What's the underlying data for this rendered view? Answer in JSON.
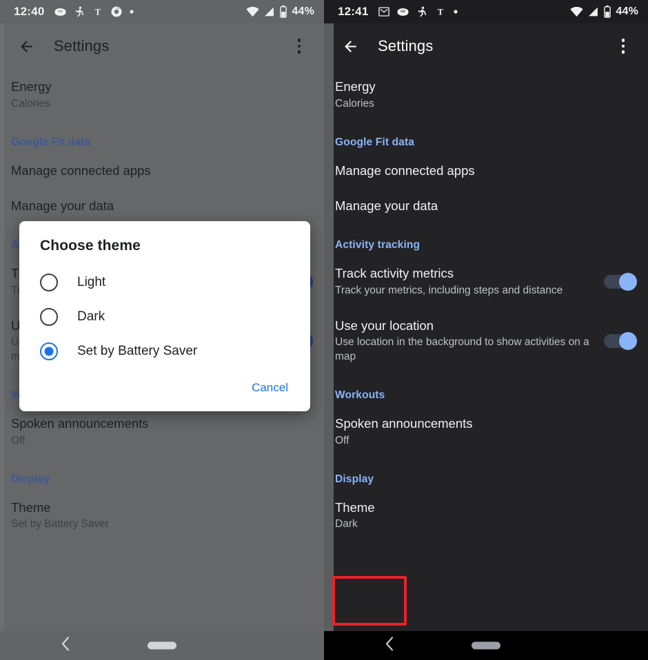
{
  "left_panel": {
    "theme": "light-scrimmed",
    "status_bar": {
      "clock": "12:40",
      "battery_text": "44%",
      "icons": [
        "fit-icon",
        "running-person-icon",
        "nyt-icon",
        "chrome-icon",
        "dot-icon"
      ],
      "right_icons": [
        "wifi-icon",
        "signal-icon",
        "battery-icon"
      ]
    },
    "app_bar": {
      "back_icon": "arrow-back-icon",
      "title": "Settings",
      "more_icon": "overflow-menu-icon"
    },
    "list": [
      {
        "kind": "item",
        "title": "Energy",
        "subtitle": "Calories"
      },
      {
        "kind": "section",
        "title": "Google Fit data"
      },
      {
        "kind": "item",
        "title": "Manage connected apps",
        "subtitle": ""
      },
      {
        "kind": "item",
        "title": "Manage your data",
        "subtitle": ""
      },
      {
        "kind": "section",
        "title": "Activity tracking"
      },
      {
        "kind": "toggle",
        "title": "Track activity metrics",
        "subtitle": "Track your metrics, including steps and distance",
        "on": true
      },
      {
        "kind": "toggle",
        "title": "Use your location",
        "subtitle": "Use location in the background to show activities on a map",
        "on": true
      },
      {
        "kind": "section",
        "title": "Workouts"
      },
      {
        "kind": "item",
        "title": "Spoken announcements",
        "subtitle": "Off"
      },
      {
        "kind": "section",
        "title": "Display"
      },
      {
        "kind": "item",
        "title": "Theme",
        "subtitle": "Set by Battery Saver"
      }
    ],
    "dialog": {
      "title": "Choose theme",
      "options": [
        {
          "label": "Light",
          "selected": false
        },
        {
          "label": "Dark",
          "selected": false
        },
        {
          "label": "Set by Battery Saver",
          "selected": true
        }
      ],
      "cancel_label": "Cancel"
    },
    "nav_bar": {
      "back_icon": "nav-back-icon",
      "home_pill": "home-pill"
    }
  },
  "right_panel": {
    "theme": "dark",
    "status_bar": {
      "clock": "12:41",
      "battery_text": "44%",
      "icons": [
        "gmail-icon",
        "fit-icon",
        "running-person-icon",
        "nyt-icon",
        "dot-icon"
      ],
      "right_icons": [
        "wifi-icon",
        "signal-icon",
        "battery-icon"
      ]
    },
    "app_bar": {
      "back_icon": "arrow-back-icon",
      "title": "Settings",
      "more_icon": "overflow-menu-icon"
    },
    "list": [
      {
        "kind": "item",
        "title": "Energy",
        "subtitle": "Calories"
      },
      {
        "kind": "section",
        "title": "Google Fit data"
      },
      {
        "kind": "item",
        "title": "Manage connected apps",
        "subtitle": ""
      },
      {
        "kind": "item",
        "title": "Manage your data",
        "subtitle": ""
      },
      {
        "kind": "section",
        "title": "Activity tracking"
      },
      {
        "kind": "toggle",
        "title": "Track activity metrics",
        "subtitle": "Track your metrics, including steps and distance",
        "on": true
      },
      {
        "kind": "toggle",
        "title": "Use your location",
        "subtitle": "Use location in the background to show activities on a map",
        "on": true
      },
      {
        "kind": "section",
        "title": "Workouts"
      },
      {
        "kind": "item",
        "title": "Spoken announcements",
        "subtitle": "Off"
      },
      {
        "kind": "section",
        "title": "Display"
      },
      {
        "kind": "item",
        "title": "Theme",
        "subtitle": "Dark",
        "highlighted": true
      }
    ],
    "nav_bar": {
      "back_icon": "nav-back-icon",
      "home_pill": "home-pill"
    }
  },
  "colors": {
    "accent_blue_light_theme": "#1a73e8",
    "accent_blue_dark_theme": "#8ab4f8",
    "highlight_box": "#e8232a",
    "dark_background": "#232326",
    "scrim_background": "#666769",
    "dialog_background": "#ffffff"
  }
}
